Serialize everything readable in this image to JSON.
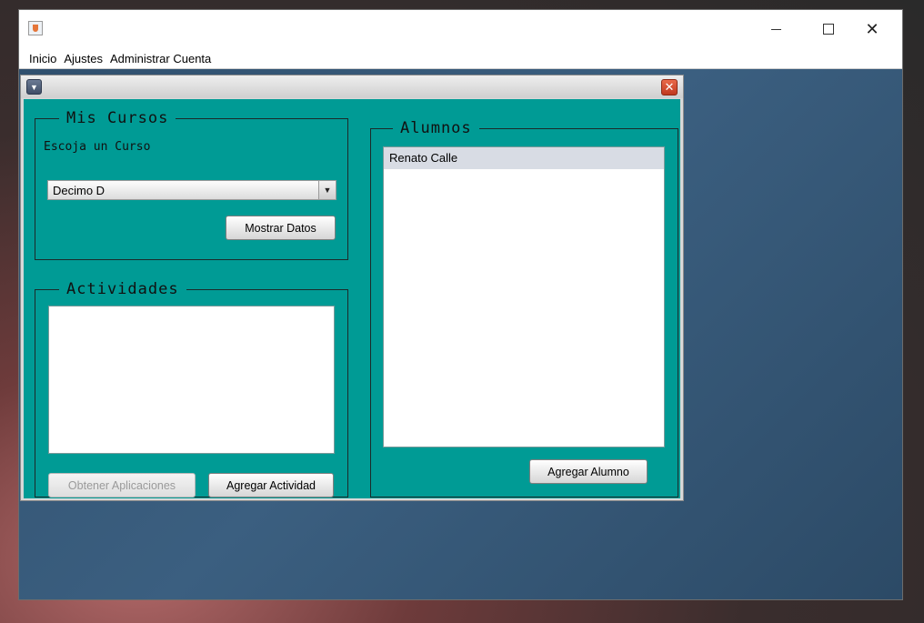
{
  "window": {
    "title": "",
    "menu": [
      "Inicio",
      "Ajustes",
      "Administrar Cuenta"
    ]
  },
  "controls": {
    "minimize": "—",
    "maximize": "☐",
    "close": "✕"
  },
  "internal_frame": {
    "menu_glyph": "▼",
    "close_glyph": "✕"
  },
  "mis_cursos": {
    "title": "Mis Cursos",
    "prompt": "Escoja un Curso",
    "selected_course": "Decimo D",
    "dropdown_glyph": "▼",
    "show_button": "Mostrar Datos"
  },
  "actividades": {
    "title": "Actividades",
    "items": [],
    "get_apps_button": "Obtener Aplicaciones",
    "add_activity_button": "Agregar Actividad"
  },
  "alumnos": {
    "title": "Alumnos",
    "items": [
      "Renato Calle"
    ],
    "add_student_button": "Agregar Alumno"
  },
  "colors": {
    "panel": "#009b95",
    "close_red": "#d9452a"
  }
}
